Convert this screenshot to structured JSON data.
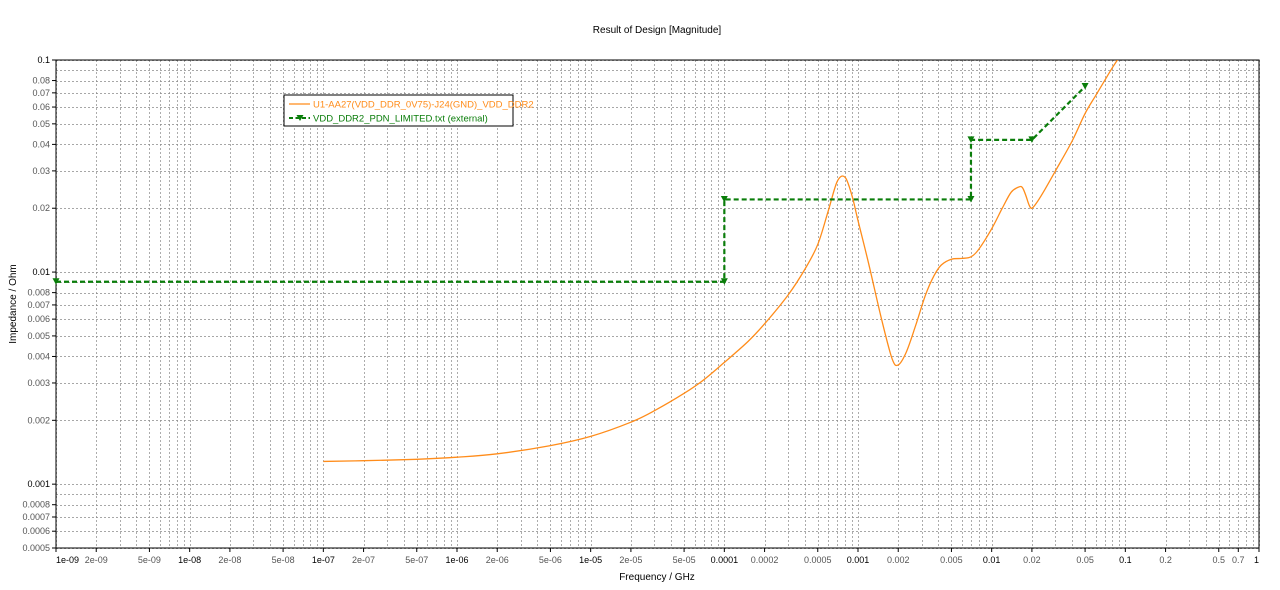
{
  "chart_data": {
    "type": "line",
    "title": "Result of Design [Magnitude]",
    "xlabel": "Frequency / GHz",
    "ylabel": "Impedance / Ohm",
    "x_scale": "log",
    "y_scale": "log",
    "xlim": [
      1e-09,
      1
    ],
    "ylim": [
      0.0005,
      0.1
    ],
    "grid": true,
    "legend_position": "top-left",
    "x_ticks": [
      {
        "v": 1e-09,
        "label": "1e-09",
        "major": true
      },
      {
        "v": 2e-09,
        "label": "2e-09",
        "major": false
      },
      {
        "v": 5e-09,
        "label": "5e-09",
        "major": false
      },
      {
        "v": 1e-08,
        "label": "1e-08",
        "major": true
      },
      {
        "v": 2e-08,
        "label": "2e-08",
        "major": false
      },
      {
        "v": 5e-08,
        "label": "5e-08",
        "major": false
      },
      {
        "v": 1e-07,
        "label": "1e-07",
        "major": true
      },
      {
        "v": 2e-07,
        "label": "2e-07",
        "major": false
      },
      {
        "v": 5e-07,
        "label": "5e-07",
        "major": false
      },
      {
        "v": 1e-06,
        "label": "1e-06",
        "major": true
      },
      {
        "v": 2e-06,
        "label": "2e-06",
        "major": false
      },
      {
        "v": 5e-06,
        "label": "5e-06",
        "major": false
      },
      {
        "v": 1e-05,
        "label": "1e-05",
        "major": true
      },
      {
        "v": 2e-05,
        "label": "2e-05",
        "major": false
      },
      {
        "v": 5e-05,
        "label": "5e-05",
        "major": false
      },
      {
        "v": 0.0001,
        "label": "0.0001",
        "major": true
      },
      {
        "v": 0.0002,
        "label": "0.0002",
        "major": false
      },
      {
        "v": 0.0005,
        "label": "0.0005",
        "major": false
      },
      {
        "v": 0.001,
        "label": "0.001",
        "major": true
      },
      {
        "v": 0.002,
        "label": "0.002",
        "major": false
      },
      {
        "v": 0.005,
        "label": "0.005",
        "major": false
      },
      {
        "v": 0.01,
        "label": "0.01",
        "major": true
      },
      {
        "v": 0.02,
        "label": "0.02",
        "major": false
      },
      {
        "v": 0.05,
        "label": "0.05",
        "major": false
      },
      {
        "v": 0.1,
        "label": "0.1",
        "major": true
      },
      {
        "v": 0.2,
        "label": "0.2",
        "major": false
      },
      {
        "v": 0.5,
        "label": "0.5",
        "major": false
      },
      {
        "v": 0.7,
        "label": "0.7",
        "major": false
      },
      {
        "v": 1,
        "label": "1",
        "major": true
      }
    ],
    "y_ticks": [
      {
        "v": 0.0005,
        "label": "0.0005",
        "major": false
      },
      {
        "v": 0.0006,
        "label": "0.0006",
        "major": false
      },
      {
        "v": 0.0007,
        "label": "0.0007",
        "major": false
      },
      {
        "v": 0.0008,
        "label": "0.0008",
        "major": false
      },
      {
        "v": 0.001,
        "label": "0.001",
        "major": true
      },
      {
        "v": 0.002,
        "label": "0.002",
        "major": false
      },
      {
        "v": 0.003,
        "label": "0.003",
        "major": false
      },
      {
        "v": 0.004,
        "label": "0.004",
        "major": false
      },
      {
        "v": 0.005,
        "label": "0.005",
        "major": false
      },
      {
        "v": 0.006,
        "label": "0.006",
        "major": false
      },
      {
        "v": 0.007,
        "label": "0.007",
        "major": false
      },
      {
        "v": 0.008,
        "label": "0.008",
        "major": false
      },
      {
        "v": 0.01,
        "label": "0.01",
        "major": true
      },
      {
        "v": 0.02,
        "label": "0.02",
        "major": false
      },
      {
        "v": 0.03,
        "label": "0.03",
        "major": false
      },
      {
        "v": 0.04,
        "label": "0.04",
        "major": false
      },
      {
        "v": 0.05,
        "label": "0.05",
        "major": false
      },
      {
        "v": 0.06,
        "label": "0.06",
        "major": false
      },
      {
        "v": 0.07,
        "label": "0.07",
        "major": false
      },
      {
        "v": 0.08,
        "label": "0.08",
        "major": false
      },
      {
        "v": 0.1,
        "label": "0.1",
        "major": true
      }
    ],
    "x_minor_gridlines": [
      3e-09,
      4e-09,
      6e-09,
      7e-09,
      8e-09,
      9e-09,
      3e-08,
      4e-08,
      6e-08,
      7e-08,
      8e-08,
      9e-08,
      3e-07,
      4e-07,
      6e-07,
      7e-07,
      8e-07,
      9e-07,
      3e-06,
      4e-06,
      6e-06,
      7e-06,
      8e-06,
      9e-06,
      3e-05,
      4e-05,
      6e-05,
      7e-05,
      8e-05,
      9e-05,
      0.0003,
      0.0004,
      0.0006,
      0.0007,
      0.0008,
      0.0009,
      0.003,
      0.004,
      0.006,
      0.007,
      0.008,
      0.009,
      0.03,
      0.04,
      0.06,
      0.07,
      0.08,
      0.09,
      0.3,
      0.4,
      0.6,
      0.8,
      0.9
    ],
    "y_minor_gridlines": [
      0.0009,
      0.009,
      0.09
    ],
    "series": [
      {
        "name": "U1-AA27(VDD_DDR_0V75)-J24(GND)_VDD_DDR2",
        "color": "#ff8c1a",
        "style": "solid",
        "x": [
          1e-07,
          2e-07,
          5e-07,
          1e-06,
          2e-06,
          5e-06,
          1e-05,
          2e-05,
          3e-05,
          5e-05,
          7e-05,
          0.0001,
          0.00015,
          0.0002,
          0.0003,
          0.0004,
          0.0005,
          0.0006,
          0.0007,
          0.0008,
          0.0009,
          0.001,
          0.0012,
          0.0015,
          0.0018,
          0.002,
          0.0023,
          0.0027,
          0.0032,
          0.0037,
          0.0042,
          0.005,
          0.006,
          0.007,
          0.008,
          0.01,
          0.012,
          0.014,
          0.016,
          0.017,
          0.018,
          0.019,
          0.02,
          0.022,
          0.025,
          0.03,
          0.04,
          0.05,
          0.06,
          0.07,
          0.08,
          0.09
        ],
        "y": [
          0.00128,
          0.00129,
          0.00131,
          0.00134,
          0.00139,
          0.00152,
          0.00168,
          0.00196,
          0.00222,
          0.00268,
          0.0031,
          0.00375,
          0.0047,
          0.0057,
          0.0078,
          0.0103,
          0.0135,
          0.0195,
          0.0268,
          0.028,
          0.023,
          0.0175,
          0.011,
          0.006,
          0.0039,
          0.00365,
          0.0042,
          0.0056,
          0.0078,
          0.0096,
          0.0108,
          0.0115,
          0.0116,
          0.0118,
          0.0128,
          0.016,
          0.02,
          0.0238,
          0.0252,
          0.025,
          0.023,
          0.0208,
          0.02,
          0.0215,
          0.0245,
          0.03,
          0.0415,
          0.056,
          0.068,
          0.08,
          0.092,
          0.103
        ]
      },
      {
        "name": "VDD_DDR2_PDN_LIMITED.txt (external)",
        "color": "#0a7d0a",
        "style": "dashed",
        "marker": "triangle-down",
        "x": [
          1e-09,
          0.0001,
          0.0001,
          0.007,
          0.007,
          0.02,
          0.05
        ],
        "y": [
          0.009,
          0.009,
          0.022,
          0.022,
          0.042,
          0.042,
          0.075
        ]
      }
    ]
  }
}
